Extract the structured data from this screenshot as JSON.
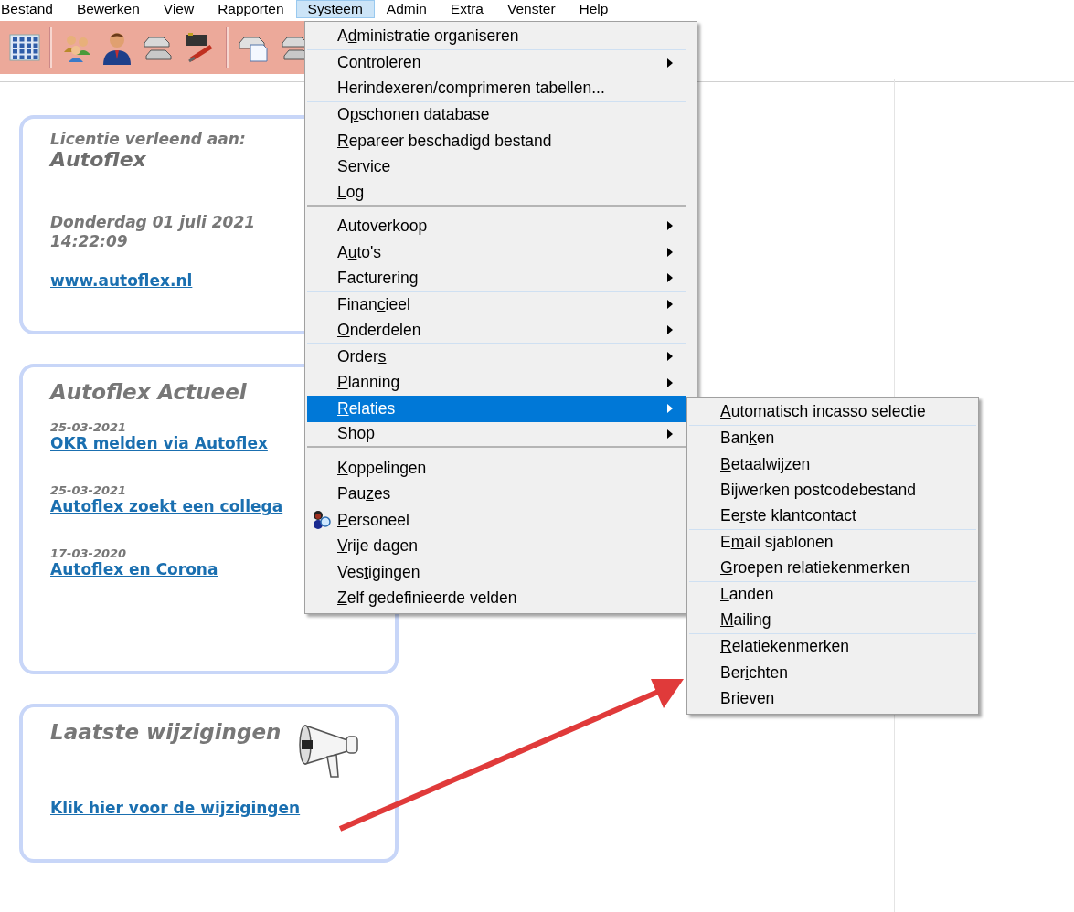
{
  "menu_bar": [
    {
      "label": "Bestand",
      "selected": false
    },
    {
      "label": "Bewerken",
      "selected": false
    },
    {
      "label": "View",
      "selected": false
    },
    {
      "label": "Rapporten",
      "selected": false
    },
    {
      "label": "Systeem",
      "selected": true
    },
    {
      "label": "Admin",
      "selected": false
    },
    {
      "label": "Extra",
      "selected": false
    },
    {
      "label": "Venster",
      "selected": false
    },
    {
      "label": "Help",
      "selected": false
    }
  ],
  "toolbar": [
    {
      "kind": "grid"
    },
    {
      "kind": "divider"
    },
    {
      "kind": "people"
    },
    {
      "kind": "person"
    },
    {
      "kind": "cars"
    },
    {
      "kind": "parts"
    },
    {
      "kind": "divider"
    },
    {
      "kind": "car-doc"
    },
    {
      "kind": "car"
    }
  ],
  "license_card": {
    "caption": "Licentie verleend aan:",
    "licensee": "Autoflex",
    "date": "Donderdag 01 juli 2021",
    "time": "14:22:09",
    "link": "www.autoflex.nl"
  },
  "news_card": {
    "title": "Autoflex Actueel",
    "items": [
      {
        "date": "25-03-2021",
        "link": "OKR melden via Autoflex"
      },
      {
        "date": "25-03-2021",
        "link": "Autoflex zoekt een collega"
      },
      {
        "date": "17-03-2020",
        "link": "Autoflex en Corona"
      }
    ]
  },
  "changes_card": {
    "title": "Laatste wijzigingen",
    "link": "Klik hier voor de wijzigingen"
  },
  "system_menu": [
    {
      "label_before": "A",
      "access_key": "d",
      "label_after": "ministratie organiseren",
      "submenu": false,
      "selected": false,
      "line_after": true
    },
    {
      "access_key": "C",
      "label_after": "ontroleren",
      "submenu": true,
      "selected": false
    },
    {
      "label_before": "Herindexeren/comprimeren tabellen...",
      "submenu": false,
      "selected": false,
      "line_after": true
    },
    {
      "label_before": "O",
      "access_key": "p",
      "label_after": "schonen database",
      "submenu": false,
      "selected": false
    },
    {
      "access_key": "R",
      "label_after": "epareer beschadigd bestand",
      "submenu": false,
      "selected": false
    },
    {
      "label_before": "Service",
      "submenu": false,
      "selected": false
    },
    {
      "access_key": "L",
      "label_after": "og",
      "submenu": false,
      "selected": false,
      "rule_after": true
    },
    {
      "label_before": "Autoverkoop",
      "submenu": true,
      "selected": false,
      "line_after": true
    },
    {
      "label_before": "A",
      "access_key": "u",
      "label_after": "to's",
      "submenu": true,
      "selected": false
    },
    {
      "label_before": "Facturerin",
      "access_key": "g",
      "submenu": true,
      "selected": false,
      "line_after": true
    },
    {
      "label_before": "Finan",
      "access_key": "c",
      "label_after": "ieel",
      "submenu": true,
      "selected": false
    },
    {
      "access_key": "O",
      "label_after": "nderdelen",
      "submenu": true,
      "selected": false,
      "line_after": true
    },
    {
      "label_before": "Order",
      "access_key": "s",
      "submenu": true,
      "selected": false
    },
    {
      "access_key": "P",
      "label_after": "lanning",
      "submenu": true,
      "selected": false
    },
    {
      "access_key": "R",
      "label_after": "elaties",
      "submenu": true,
      "selected": true
    },
    {
      "label_before": "S",
      "access_key": "h",
      "label_after": "op",
      "submenu": true,
      "selected": false,
      "rule_after": true
    },
    {
      "access_key": "K",
      "label_after": "oppelingen",
      "submenu": false,
      "selected": false
    },
    {
      "label_before": "Pau",
      "access_key": "z",
      "label_after": "es",
      "submenu": false,
      "selected": false
    },
    {
      "access_key": "P",
      "label_after": "ersoneel",
      "submenu": false,
      "selected": false,
      "icon": true
    },
    {
      "access_key": "V",
      "label_after": "rije dagen",
      "submenu": false,
      "selected": false
    },
    {
      "label_before": "Ves",
      "access_key": "t",
      "label_after": "igingen",
      "submenu": false,
      "selected": false
    },
    {
      "access_key": "Z",
      "label_after": "elf gedefinieerde velden",
      "submenu": false,
      "selected": false
    }
  ],
  "relaties_submenu": [
    {
      "access_key": "A",
      "label_after": "utomatisch incasso selectie",
      "line_after": true
    },
    {
      "label_before": "Ban",
      "access_key": "k",
      "label_after": "en"
    },
    {
      "access_key": "B",
      "label_after": "etaalwijzen"
    },
    {
      "label_before": "Bi",
      "access_key": "j",
      "label_after": "werken postcodebestand"
    },
    {
      "label_before": "Ee",
      "access_key": "r",
      "label_after": "ste klantcontact",
      "line_after": true
    },
    {
      "label_before": "E",
      "access_key": "m",
      "label_after": "ail sjablonen"
    },
    {
      "access_key": "G",
      "label_after": "roepen relatiekenmerken",
      "line_after": true
    },
    {
      "access_key": "L",
      "label_after": "anden"
    },
    {
      "access_key": "M",
      "label_after": "ailing",
      "line_after": true
    },
    {
      "access_key": "R",
      "label_after": "elatiekenmerken"
    },
    {
      "label_before": "Ber",
      "access_key": "i",
      "label_after": "chten"
    },
    {
      "label_before": "B",
      "access_key": "r",
      "label_after": "ieven"
    }
  ]
}
